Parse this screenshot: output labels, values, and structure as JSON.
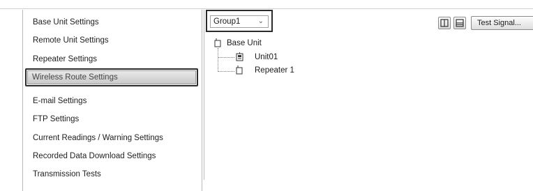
{
  "sidebar": {
    "items": [
      {
        "label": "Base Unit Settings",
        "selected": false
      },
      {
        "label": "Remote Unit Settings",
        "selected": false
      },
      {
        "label": "Repeater Settings",
        "selected": false
      },
      {
        "label": "Wireless Route Settings",
        "selected": true
      },
      {
        "label": "E-mail Settings",
        "selected": false
      },
      {
        "label": "FTP Settings",
        "selected": false
      },
      {
        "label": "Current Readings / Warning Settings",
        "selected": false
      },
      {
        "label": "Recorded Data Download Settings",
        "selected": false
      },
      {
        "label": "Transmission Tests",
        "selected": false
      }
    ]
  },
  "toolbar": {
    "group_select": {
      "value": "Group1"
    },
    "test_signal_label": "Test Signal...",
    "layout_buttons": [
      "split-vertical-icon",
      "split-horizontal-icon"
    ]
  },
  "tree": {
    "root": {
      "label": "Base Unit",
      "icon": "base-unit-icon"
    },
    "children": [
      {
        "label": "Unit01",
        "icon": "remote-unit-icon"
      },
      {
        "label": "Repeater 1",
        "icon": "repeater-icon"
      }
    ]
  },
  "colors": {
    "selected_border": "#2b2b2b",
    "selected_fill": "#d8d8d8",
    "panel_border": "#b9b9b9"
  }
}
